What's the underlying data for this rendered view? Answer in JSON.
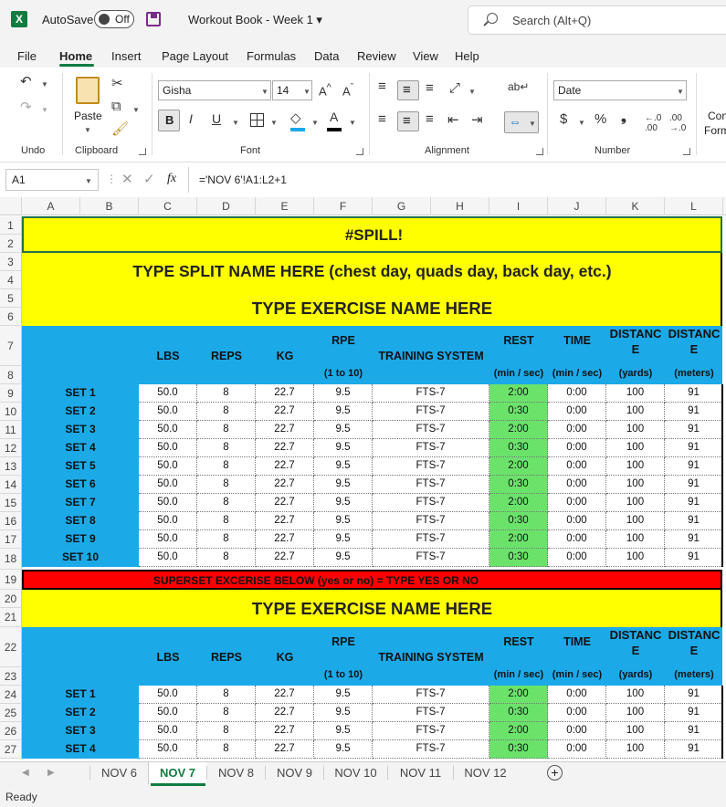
{
  "titlebar": {
    "autosave": "AutoSave",
    "toggle": "Off",
    "doc_title": "Workout Book - Week 1 ▾",
    "search_placeholder": "Search (Alt+Q)"
  },
  "menu": {
    "file": "File",
    "home": "Home",
    "insert": "Insert",
    "page_layout": "Page Layout",
    "formulas": "Formulas",
    "data": "Data",
    "review": "Review",
    "view": "View",
    "help": "Help"
  },
  "ribbon": {
    "undo_group": "Undo",
    "clipboard_group": "Clipboard",
    "paste": "Paste",
    "font_group": "Font",
    "font_name": "Gisha",
    "font_size": "14",
    "alignment_group": "Alignment",
    "number_group": "Number",
    "number_format": "Date",
    "cond_format": "Con",
    "format_as": "Form",
    "bold": "B",
    "italic": "I",
    "underline": "U",
    "currency": "$",
    "percent": "%",
    "comma": "❟"
  },
  "formula_bar": {
    "name_box": "A1",
    "fx": "fx",
    "formula": "='NOV 6'!A1:L2+1"
  },
  "columns": [
    "A",
    "B",
    "C",
    "D",
    "E",
    "F",
    "G",
    "H",
    "I",
    "J",
    "K",
    "L"
  ],
  "rows": [
    "1",
    "2",
    "3",
    "4",
    "5",
    "6",
    "7",
    "8",
    "9",
    "10",
    "11",
    "12",
    "13",
    "14",
    "15",
    "16",
    "17",
    "18",
    "19",
    "20",
    "21",
    "22",
    "23",
    "24",
    "25",
    "26",
    "27"
  ],
  "sheet": {
    "spill": "#SPILL!",
    "split_title": "TYPE SPLIT NAME HERE (chest day, quads day, back day, etc.)",
    "exercise_title": "TYPE EXERCISE NAME HERE",
    "superset": "SUPERSET EXCERISE BELOW (yes or no) = TYPE YES OR NO",
    "headers": {
      "lbs": "LBS",
      "reps": "REPS",
      "kg": "KG",
      "rpe": "RPE",
      "rpe_sub": "(1 to 10)",
      "system": "TRAINING SYSTEM",
      "rest": "REST",
      "rest_sub": "(min / sec)",
      "time": "TIME",
      "time_sub": "(min / sec)",
      "dist_yd": "DISTANC E",
      "dist_yd_sub": "(yards)",
      "dist_m": "DISTANC E",
      "dist_m_sub": "(meters)"
    },
    "block1": [
      [
        "SET 1",
        "50.0",
        "8",
        "22.7",
        "9.5",
        "FTS-7",
        "2:00",
        "0:00",
        "100",
        "91"
      ],
      [
        "SET 2",
        "50.0",
        "8",
        "22.7",
        "9.5",
        "FTS-7",
        "0:30",
        "0:00",
        "100",
        "91"
      ],
      [
        "SET 3",
        "50.0",
        "8",
        "22.7",
        "9.5",
        "FTS-7",
        "2:00",
        "0:00",
        "100",
        "91"
      ],
      [
        "SET 4",
        "50.0",
        "8",
        "22.7",
        "9.5",
        "FTS-7",
        "0:30",
        "0:00",
        "100",
        "91"
      ],
      [
        "SET 5",
        "50.0",
        "8",
        "22.7",
        "9.5",
        "FTS-7",
        "2:00",
        "0:00",
        "100",
        "91"
      ],
      [
        "SET 6",
        "50.0",
        "8",
        "22.7",
        "9.5",
        "FTS-7",
        "0:30",
        "0:00",
        "100",
        "91"
      ],
      [
        "SET 7",
        "50.0",
        "8",
        "22.7",
        "9.5",
        "FTS-7",
        "2:00",
        "0:00",
        "100",
        "91"
      ],
      [
        "SET 8",
        "50.0",
        "8",
        "22.7",
        "9.5",
        "FTS-7",
        "0:30",
        "0:00",
        "100",
        "91"
      ],
      [
        "SET 9",
        "50.0",
        "8",
        "22.7",
        "9.5",
        "FTS-7",
        "2:00",
        "0:00",
        "100",
        "91"
      ],
      [
        "SET 10",
        "50.0",
        "8",
        "22.7",
        "9.5",
        "FTS-7",
        "0:30",
        "0:00",
        "100",
        "91"
      ]
    ],
    "block2": [
      [
        "SET 1",
        "50.0",
        "8",
        "22.7",
        "9.5",
        "FTS-7",
        "2:00",
        "0:00",
        "100",
        "91"
      ],
      [
        "SET 2",
        "50.0",
        "8",
        "22.7",
        "9.5",
        "FTS-7",
        "0:30",
        "0:00",
        "100",
        "91"
      ],
      [
        "SET 3",
        "50.0",
        "8",
        "22.7",
        "9.5",
        "FTS-7",
        "2:00",
        "0:00",
        "100",
        "91"
      ],
      [
        "SET 4",
        "50.0",
        "8",
        "22.7",
        "9.5",
        "FTS-7",
        "0:30",
        "0:00",
        "100",
        "91"
      ]
    ]
  },
  "tabs": [
    "NOV 6",
    "NOV 7",
    "NOV 8",
    "NOV 9",
    "NOV 10",
    "NOV 11",
    "NOV 12"
  ],
  "active_tab": "NOV 7",
  "status": "Ready",
  "colors": {
    "accent": "#107c41",
    "yellow": "#ffff00",
    "blue": "#1ca9e8",
    "red": "#ff0000",
    "rest_green": "#6be36b"
  }
}
